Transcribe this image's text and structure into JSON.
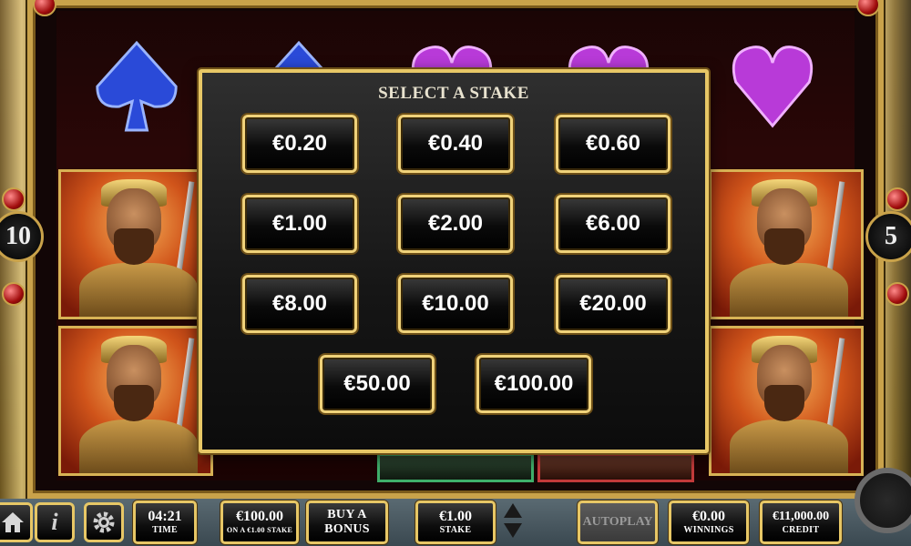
{
  "modal": {
    "title": "SELECT A STAKE",
    "stakes": [
      "€0.20",
      "€0.40",
      "€0.60",
      "€1.00",
      "€2.00",
      "€6.00",
      "€8.00",
      "€10.00",
      "€20.00",
      "€50.00",
      "€100.00"
    ]
  },
  "badges": {
    "left": "10",
    "right": "5"
  },
  "bottom": {
    "time_value": "04:21",
    "time_label": "TIME",
    "bonus_value": "€100.00",
    "bonus_caption": "ON A €1.00 STAKE",
    "buy_bonus_line1": "BUY A",
    "buy_bonus_line2": "BONUS",
    "stake_value": "€1.00",
    "stake_label": "STAKE",
    "autoplay_label": "AUTOPLAY",
    "winnings_value": "€0.00",
    "winnings_label": "WINNINGS",
    "credit_value": "€11,000.00",
    "credit_label": "CREDIT"
  },
  "icons": [
    "home-icon",
    "info-icon",
    "gear-icon",
    "stake-up-icon",
    "stake-down-icon",
    "spin-icon"
  ],
  "colors": {
    "gold": "#e7c766",
    "gem_blue": "#2a4ad8",
    "gem_purple": "#b83ad8"
  }
}
